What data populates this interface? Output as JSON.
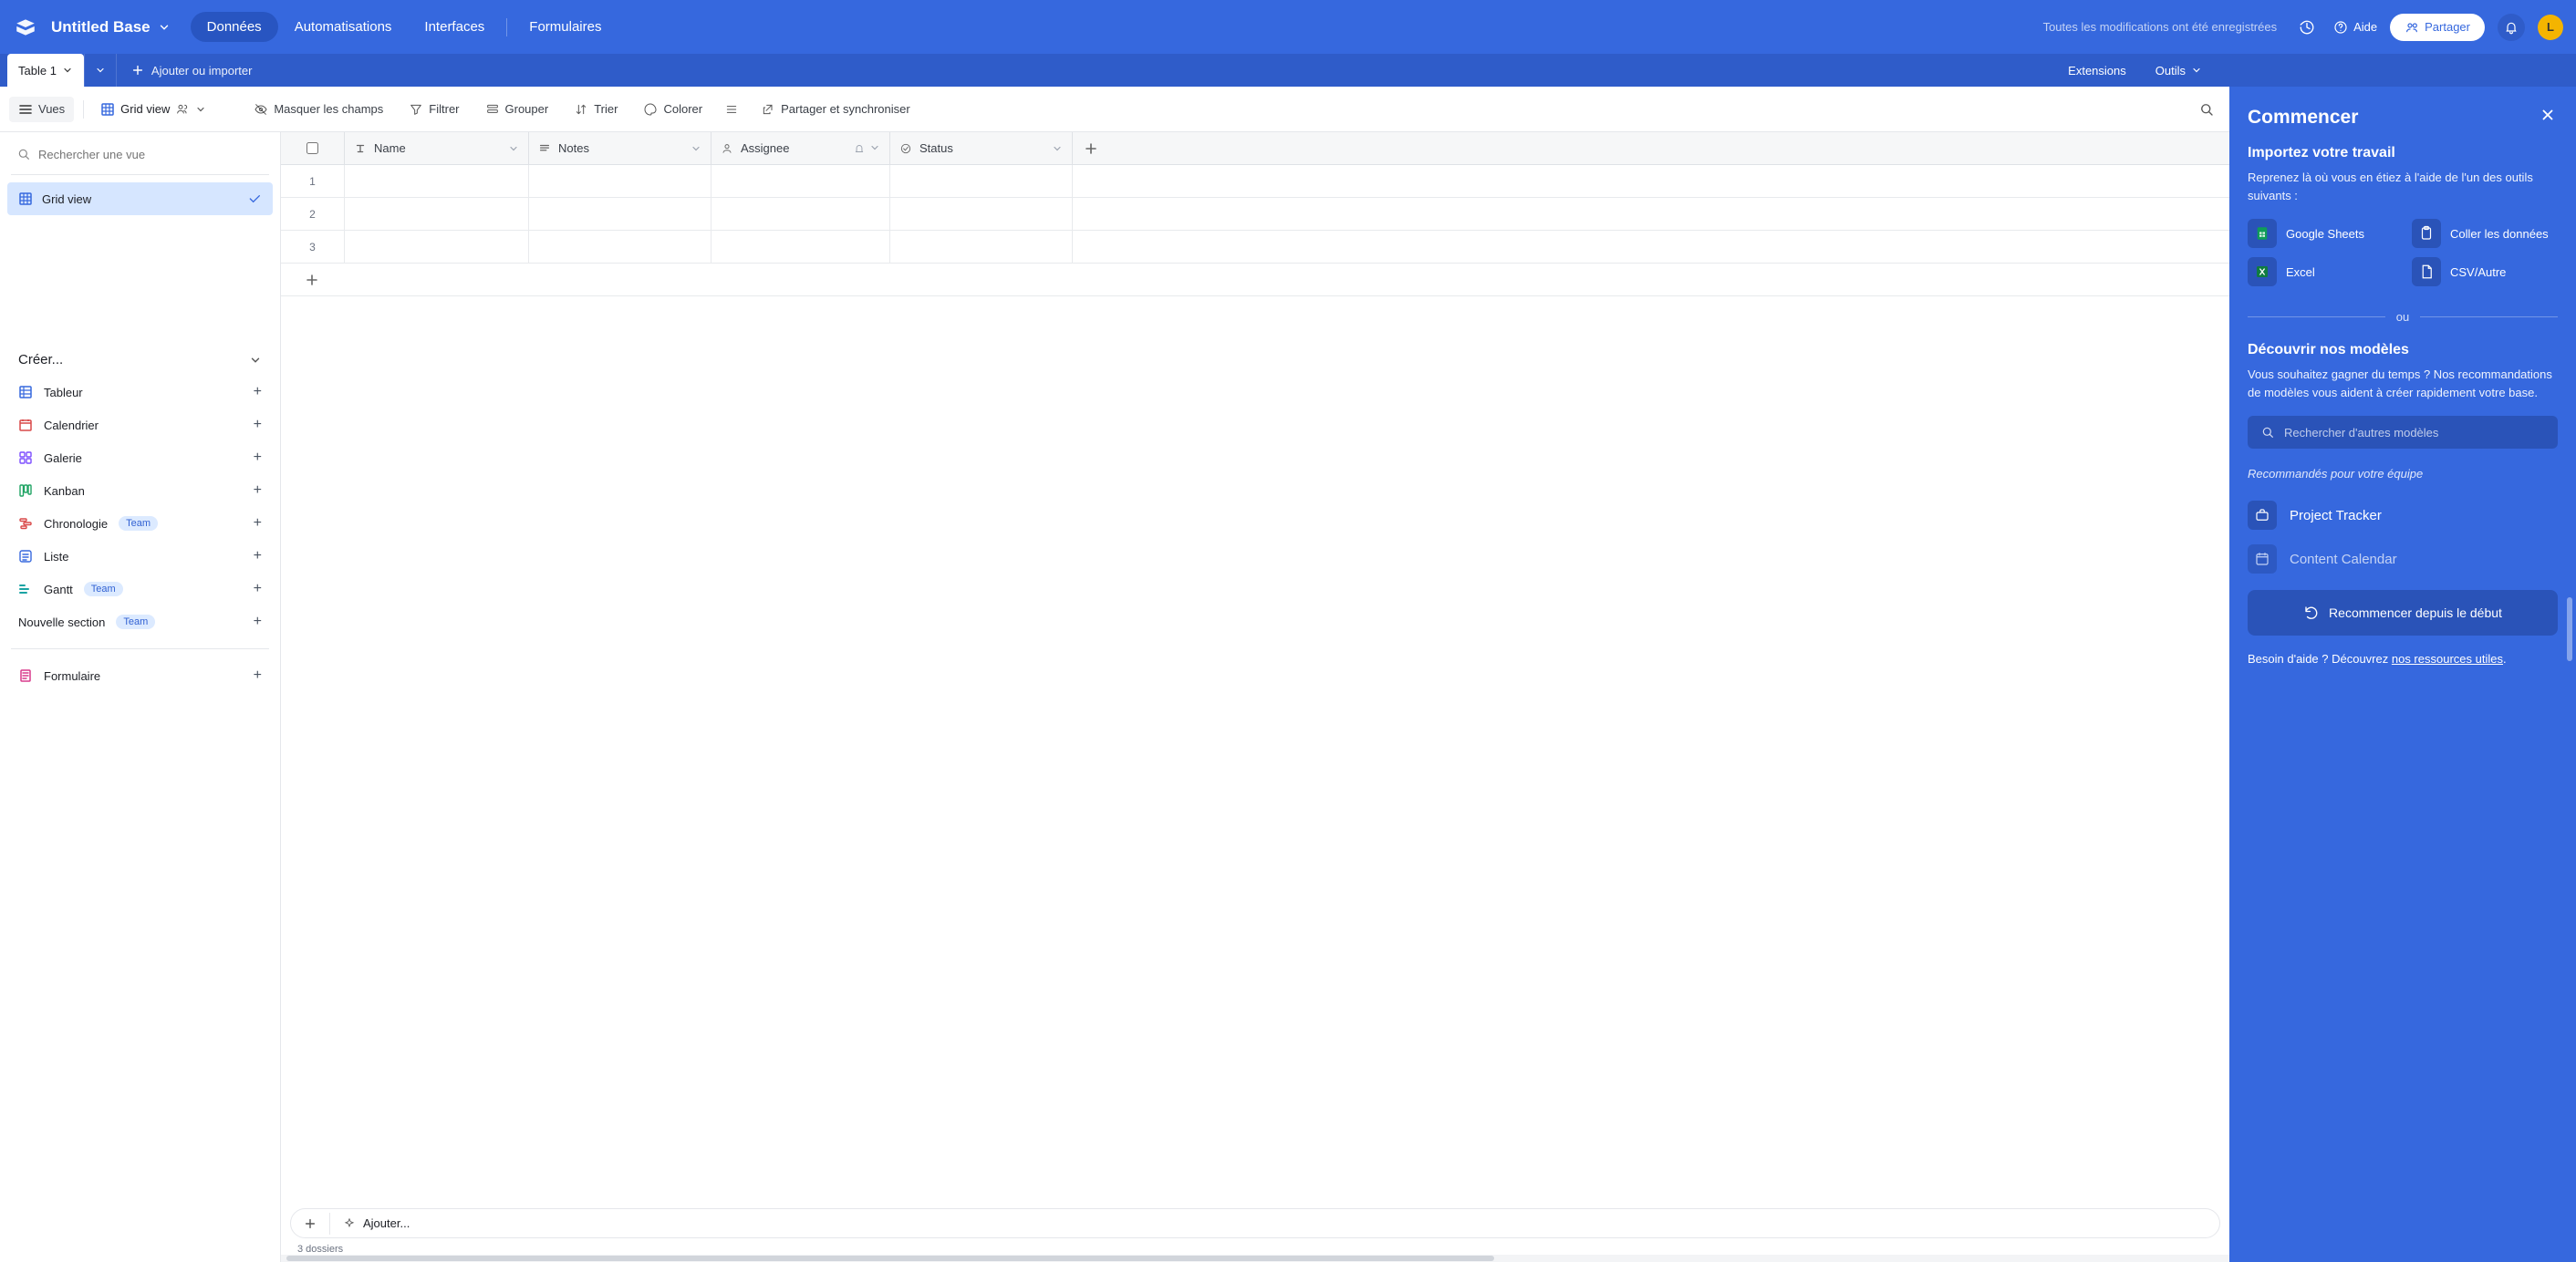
{
  "topbar": {
    "base_title": "Untitled Base",
    "nav": {
      "data": "Données",
      "automations": "Automatisations",
      "interfaces": "Interfaces",
      "forms": "Formulaires"
    },
    "save_status": "Toutes les modifications ont été enregistrées",
    "help": "Aide",
    "share": "Partager",
    "avatar_letter": "L"
  },
  "tables_bar": {
    "table_tab": "Table 1",
    "add_import": "Ajouter ou importer",
    "extensions": "Extensions",
    "tools": "Outils"
  },
  "viewbar": {
    "views": "Vues",
    "grid_view": "Grid view",
    "hide_fields": "Masquer les champs",
    "filter": "Filtrer",
    "group": "Grouper",
    "sort": "Trier",
    "color": "Colorer",
    "share_sync": "Partager et synchroniser"
  },
  "left_panel": {
    "search_placeholder": "Rechercher une vue",
    "grid_view": "Grid view",
    "create_header": "Créer...",
    "items": {
      "table": "Tableur",
      "calendar": "Calendrier",
      "gallery": "Galerie",
      "kanban": "Kanban",
      "timeline": "Chronologie",
      "list": "Liste",
      "gantt": "Gantt",
      "new_section": "Nouvelle section",
      "form": "Formulaire"
    },
    "team_badge": "Team"
  },
  "grid": {
    "columns": {
      "name": "Name",
      "notes": "Notes",
      "assignee": "Assignee",
      "status": "Status"
    },
    "rows": [
      "1",
      "2",
      "3"
    ],
    "footer_add": "Ajouter...",
    "record_count": "3 dossiers"
  },
  "right_panel": {
    "title": "Commencer",
    "import_title": "Importez votre travail",
    "import_desc": "Reprenez là où vous en étiez à l'aide de l'un des outils suivants :",
    "imports": {
      "google_sheets": "Google Sheets",
      "paste": "Coller les données",
      "excel": "Excel",
      "csv": "CSV/Autre"
    },
    "or": "ou",
    "templates_title": "Découvrir nos modèles",
    "templates_desc": "Vous souhaitez gagner du temps ? Nos recommandations de modèles vous aident à créer rapidement votre base.",
    "search_placeholder": "Rechercher d'autres modèles",
    "recommended_label": "Recommandés pour votre équipe",
    "templates": {
      "project_tracker": "Project Tracker",
      "content_calendar": "Content Calendar"
    },
    "restart": "Recommencer depuis le début",
    "help_prefix": "Besoin d'aide ? Découvrez ",
    "help_link": "nos ressources utiles",
    "help_suffix": "."
  }
}
